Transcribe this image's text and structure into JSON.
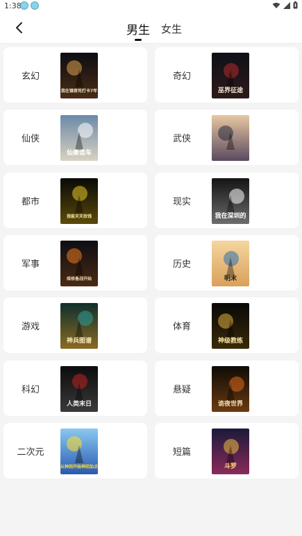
{
  "status": {
    "time": "1:38"
  },
  "header": {
    "tabs": [
      {
        "label": "男生",
        "active": true
      },
      {
        "label": "女生",
        "active": false
      }
    ]
  },
  "colors": {
    "background": "#f4f4f4",
    "card": "#ffffff",
    "text": "#333333"
  },
  "categories": [
    {
      "label": "玄幻",
      "cover_title": "我在镇夜司打卡7年",
      "cover_bg": [
        "#0d0d12",
        "#4a2c16"
      ],
      "accent": "#e0a250",
      "text_color": "#f3e6c8"
    },
    {
      "label": "奇幻",
      "cover_title": "巫界征途",
      "cover_bg": [
        "#101018",
        "#2d1a1a"
      ],
      "accent": "#b22a2a",
      "text_color": "#f0e6d0"
    },
    {
      "label": "仙侠",
      "cover_title": "仙秦造车",
      "cover_bg": [
        "#6b89a8",
        "#d9d2c0"
      ],
      "accent": "#ffffff",
      "text_color": "#ffffff"
    },
    {
      "label": "武侠",
      "cover_title": "",
      "cover_bg": [
        "#e7c7a2",
        "#5a4a60"
      ],
      "accent": "#2a2a3a",
      "text_color": "#ffffff"
    },
    {
      "label": "都市",
      "cover_title": "我能天天捡钱",
      "cover_bg": [
        "#0a0a06",
        "#5a4a0a"
      ],
      "accent": "#e8c92a",
      "text_color": "#f8e8a0"
    },
    {
      "label": "现实",
      "cover_title": "我在深圳的",
      "cover_bg": [
        "#141414",
        "#6d6d6d"
      ],
      "accent": "#ffffff",
      "text_color": "#ffffff"
    },
    {
      "label": "军事",
      "cover_title": "维修备战开始",
      "cover_bg": [
        "#0e0e14",
        "#4a2a12"
      ],
      "accent": "#f07a1e",
      "text_color": "#e8d8b0"
    },
    {
      "label": "历史",
      "cover_title": "明末",
      "cover_bg": [
        "#f4d6a0",
        "#d9a05a"
      ],
      "accent": "#2a6fb0",
      "text_color": "#1a1a1a"
    },
    {
      "label": "游戏",
      "cover_title": "神兵图谱",
      "cover_bg": [
        "#0f2f2c",
        "#8a6a24"
      ],
      "accent": "#2aa09a",
      "text_color": "#f5e6b8"
    },
    {
      "label": "体育",
      "cover_title": "神级教练",
      "cover_bg": [
        "#080806",
        "#3a2a0a"
      ],
      "accent": "#e0b040",
      "text_color": "#f5e6a0"
    },
    {
      "label": "科幻",
      "cover_title": "人类末日",
      "cover_bg": [
        "#0c0c0c",
        "#3a3a3a"
      ],
      "accent": "#c22020",
      "text_color": "#f0f0f0"
    },
    {
      "label": "悬疑",
      "cover_title": "诡夜世界",
      "cover_bg": [
        "#0e0b06",
        "#6a3a12"
      ],
      "accent": "#e06a1a",
      "text_color": "#f8e0b0"
    },
    {
      "label": "二次元",
      "cover_title": "从种田开始神田加点",
      "cover_bg": [
        "#8ac8f0",
        "#2a5ab0"
      ],
      "accent": "#ffde2a",
      "text_color": "#ffde2a"
    },
    {
      "label": "短篇",
      "cover_title": "斗罗",
      "cover_bg": [
        "#1a1a3a",
        "#8a2a5a"
      ],
      "accent": "#f0c040",
      "text_color": "#ffe070"
    }
  ]
}
